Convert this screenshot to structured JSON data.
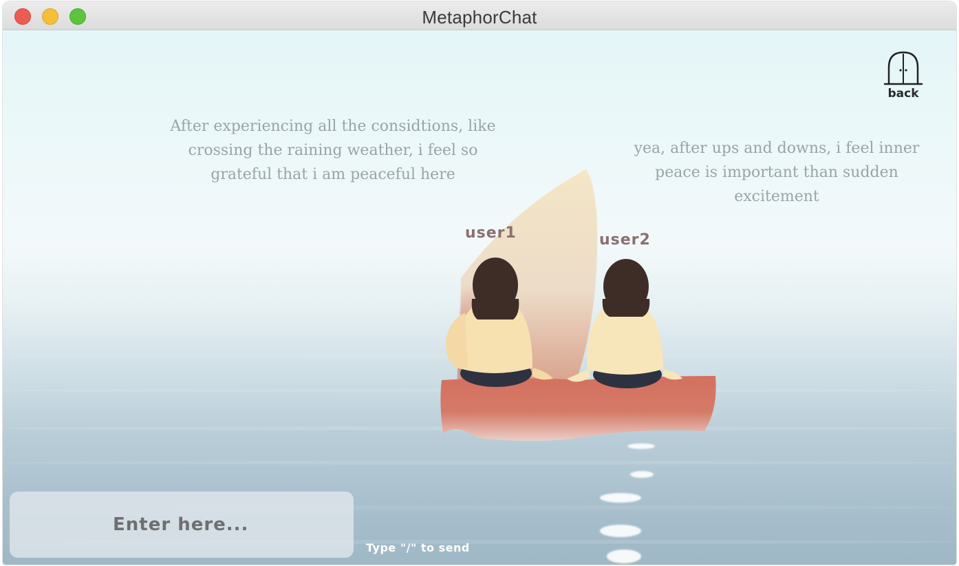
{
  "window": {
    "title": "MetaphorChat"
  },
  "messages": {
    "left": "After experiencing all the considtions, like crossing the raining weather, i feel so grateful that i am peaceful here",
    "right": "yea, after ups and downs, i feel inner peace is important than sudden excitement"
  },
  "users": {
    "user1": "user1",
    "user2": "user2"
  },
  "back": {
    "label": "back",
    "icon": "door-icon"
  },
  "input": {
    "placeholder": "Enter here...",
    "hint": "Type \"/\" to send"
  },
  "colors": {
    "sail": "#f3e8c8",
    "boat_hull": "#d5705f",
    "sweater": "#f7e1b1",
    "hair": "#3e2d27",
    "user_label": "#8c6f6f"
  }
}
